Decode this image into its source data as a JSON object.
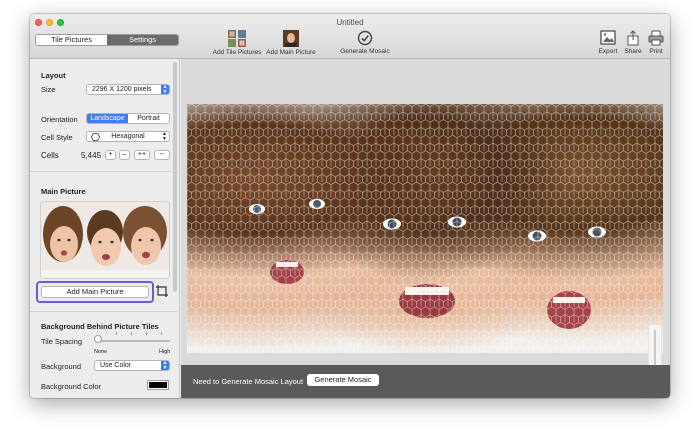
{
  "window": {
    "title": "Untitled"
  },
  "tabs": [
    {
      "label": "Tile Pictures",
      "active": false
    },
    {
      "label": "Settings",
      "active": true
    }
  ],
  "toolbar": {
    "add_tile_pictures": "Add Tile Pictures",
    "add_main_picture": "Add Main Picture",
    "generate_mosaic": "Generate Mosaic",
    "export": "Export",
    "share": "Share",
    "print": "Print"
  },
  "layout": {
    "title": "Layout",
    "size_label": "Size",
    "size_value": "2296 X 1200 pixels",
    "orientation_label": "Orientation",
    "orientation_options": [
      "Landscape",
      "Portrait"
    ],
    "orientation_selected": "Landscape",
    "cell_style_label": "Cell Style",
    "cell_style_value": "Hexagonal",
    "cells_label": "Cells",
    "cells_value": "5,445",
    "cells_buttons": [
      "+",
      "–",
      "++",
      "--"
    ]
  },
  "main_picture": {
    "title": "Main Picture",
    "add_button": "Add Main Picture"
  },
  "background": {
    "title": "Background Behind Picture Tiles",
    "tile_spacing_label": "Tile Spacing",
    "tile_spacing_min": "None",
    "tile_spacing_max": "High",
    "tile_spacing_level": 0,
    "background_label": "Background",
    "background_value": "Use Color",
    "background_color_label": "Background Color",
    "background_color": "#000000"
  },
  "status": {
    "message": "Need to Generate Mosaic Layout",
    "button": "Generate Mosaic"
  },
  "colors": {
    "accent": "#3d7ded",
    "highlight_ring": "#6d5bd8",
    "status_bar": "#5a5a5a"
  }
}
